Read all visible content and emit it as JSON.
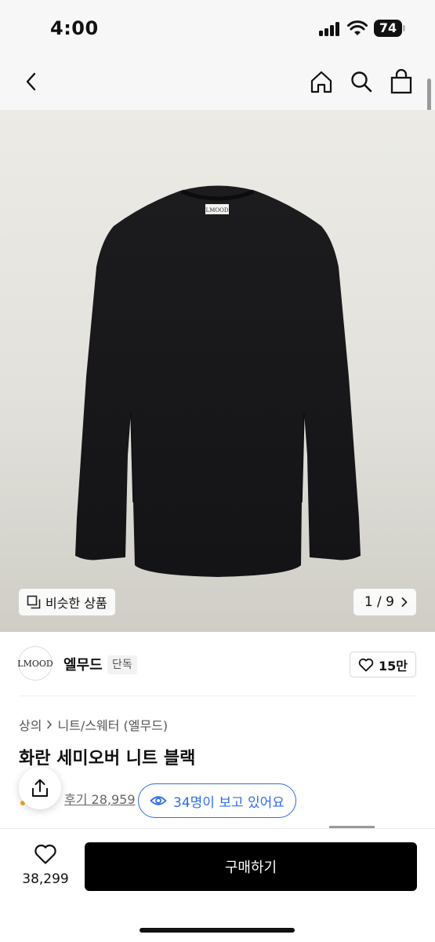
{
  "status_bar": {
    "time": "4:00",
    "battery": "74"
  },
  "nav": {
    "icons": [
      "back-icon",
      "home-icon",
      "search-icon",
      "shopping-bag-icon"
    ]
  },
  "hero": {
    "label_text": "LMOOD",
    "similar_label": "비슷한 상품",
    "image_counter": "1 / 9"
  },
  "brand": {
    "logo_text": "LMOOD",
    "name": "엘무드",
    "tag": "단독",
    "like_count": "15만"
  },
  "product": {
    "breadcrumb": [
      "상의",
      "니트/스웨터 (엘무드)"
    ],
    "title": "화란 세미오버 니트 블랙",
    "review_text": "후기 28,959",
    "viewers_text": "34명이 보고 있어요"
  },
  "bottom": {
    "wish_count": "38,299",
    "buy_label": "구매하기"
  },
  "colors": {
    "accent": "#2d6ee8",
    "buy_button": "#000000"
  }
}
